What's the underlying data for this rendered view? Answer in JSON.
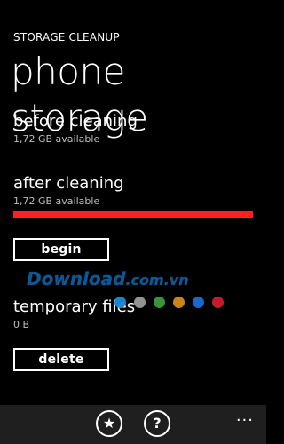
{
  "header": {
    "app_title": "STORAGE CLEANUP",
    "page_title": "phone storage"
  },
  "before": {
    "title": "before cleaning",
    "sub": "1,72 GB available"
  },
  "after": {
    "title": "after cleaning",
    "sub": "1,72 GB available"
  },
  "buttons": {
    "begin": "begin",
    "delete": "delete"
  },
  "temporary": {
    "title": "temporary files",
    "sub": "0 B"
  },
  "watermark": {
    "text": "Download",
    "tld": ".com.vn"
  },
  "theme_dots": [
    "#1e8bd8",
    "#9a9a9a",
    "#3d9a3d",
    "#d38b1c",
    "#1c6ed8",
    "#cc1f2d"
  ],
  "appbar": {
    "icons": [
      "star-icon",
      "help-icon"
    ],
    "more_label": "..."
  },
  "colors": {
    "background": "#000000",
    "accent_bar": "#ff1f1f",
    "text": "#ffffff"
  },
  "progress": {
    "after_cleaning_bar": 1.0
  }
}
